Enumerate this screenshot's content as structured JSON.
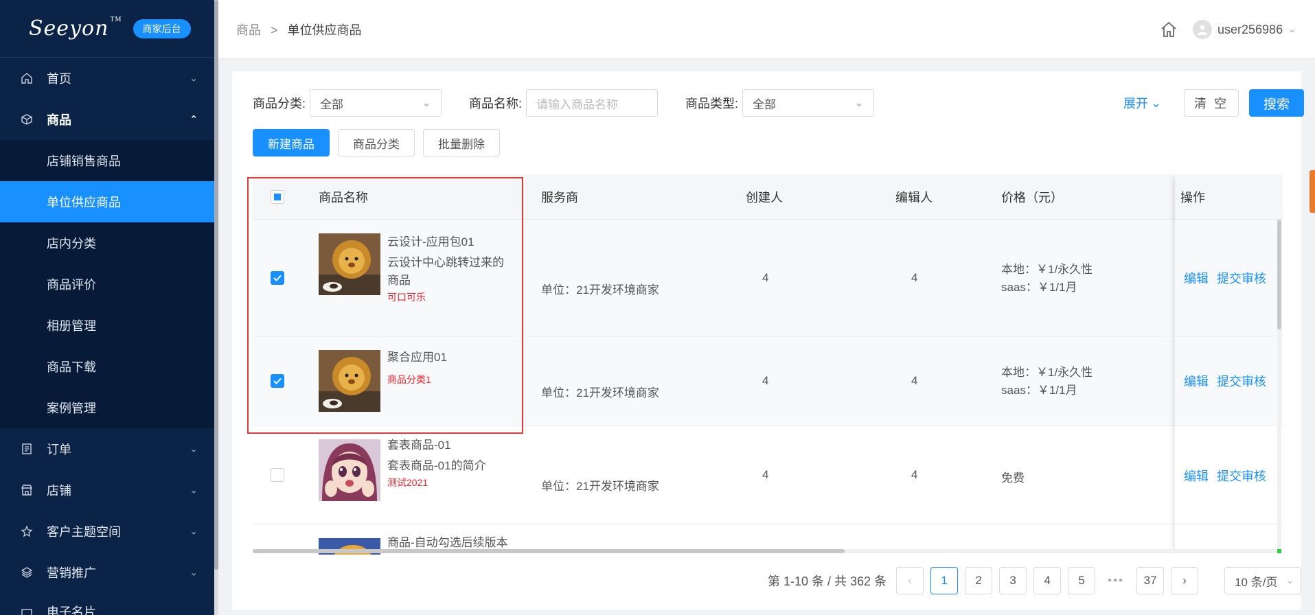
{
  "brand": {
    "logo_text": "Seeyon",
    "tm": "TM",
    "badge": "商家后台"
  },
  "sidebar": {
    "items": [
      {
        "label": "首页",
        "icon": "home-icon"
      },
      {
        "label": "商品",
        "icon": "cube-icon"
      },
      {
        "label": "订单",
        "icon": "document-icon"
      },
      {
        "label": "店铺",
        "icon": "store-icon"
      },
      {
        "label": "客户主题空间",
        "icon": "crown-icon"
      },
      {
        "label": "营销推广",
        "icon": "layers-icon"
      },
      {
        "label": "电子名片",
        "icon": "card-icon"
      }
    ],
    "sub_items": [
      "店铺销售商品",
      "单位供应商品",
      "店内分类",
      "商品评价",
      "相册管理",
      "商品下载",
      "案例管理"
    ]
  },
  "header": {
    "breadcrumb": [
      "商品",
      "单位供应商品"
    ],
    "breadcrumb_sep": ">",
    "username": "user256986"
  },
  "filters": {
    "category_label": "商品分类:",
    "category_value": "全部",
    "name_label": "商品名称:",
    "name_placeholder": "请输入商品名称",
    "type_label": "商品类型:",
    "type_value": "全部",
    "expand": "展开",
    "clear": "清 空",
    "search": "搜索"
  },
  "actions": {
    "new": "新建商品",
    "category": "商品分类",
    "batch_delete": "批量删除"
  },
  "table": {
    "columns": [
      "商品名称",
      "服务商",
      "创建人",
      "编辑人",
      "价格（元）",
      "操作"
    ],
    "rows": [
      {
        "checked": true,
        "title": "云设计-应用包01",
        "desc_line1": "云设计中心跳转过来的",
        "desc_line2": "商品",
        "tag": "可口可乐",
        "provider": "单位：21开发环境商家",
        "creator": "4",
        "editor": "4",
        "price_line1": "本地：￥1/永久性",
        "price_line2": "saas：￥1/1月",
        "op_edit": "编辑",
        "op_submit": "提交审核"
      },
      {
        "checked": true,
        "title": "聚合应用01",
        "tag": "商品分类1",
        "provider": "单位：21开发环境商家",
        "creator": "4",
        "editor": "4",
        "price_line1": "本地：￥1/永久性",
        "price_line2": "saas：￥1/1月",
        "op_edit": "编辑",
        "op_submit": "提交审核"
      },
      {
        "checked": false,
        "title": "套表商品-01",
        "desc_line1": "套表商品-01的简介",
        "tag": "测试2021",
        "provider": "单位：21开发环境商家",
        "creator": "4",
        "editor": "4",
        "price_line1": "免费",
        "op_edit": "编辑",
        "op_submit": "提交审核"
      },
      {
        "checked": false,
        "title": "商品-自动勾选后续版本"
      }
    ]
  },
  "pagination": {
    "total": "第 1-10 条 / 共 362 条",
    "pages": [
      "1",
      "2",
      "3",
      "4",
      "5"
    ],
    "ellipsis": "•••",
    "last": "37",
    "page_size": "10 条/页"
  },
  "colors": {
    "sidebar_bg": "#0c2348",
    "accent": "#1890ff",
    "highlight_border": "#e53935",
    "tag_red": "#f5222d"
  }
}
